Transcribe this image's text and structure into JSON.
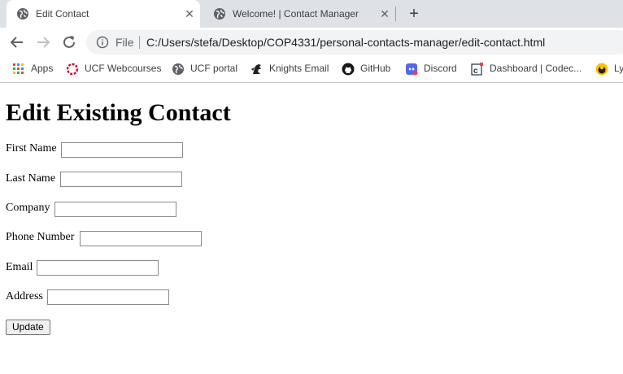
{
  "browser": {
    "tabs": [
      {
        "title": "Edit Contact",
        "close": "✕"
      },
      {
        "title": "Welcome! | Contact Manager",
        "close": "✕"
      }
    ],
    "new_tab": "+",
    "address": {
      "scheme_label": "File",
      "url": "C:/Users/stefa/Desktop/COP4331/personal-contacts-manager/edit-contact.html"
    },
    "bookmarks": [
      {
        "label": "Apps",
        "icon": "apps-grid-icon"
      },
      {
        "label": "UCF Webcourses",
        "icon": "webcourses-icon"
      },
      {
        "label": "UCF portal",
        "icon": "globe-icon"
      },
      {
        "label": "Knights Email",
        "icon": "knights-icon"
      },
      {
        "label": "GitHub",
        "icon": "github-icon"
      },
      {
        "label": "Discord",
        "icon": "discord-icon"
      },
      {
        "label": "Dashboard | Codec...",
        "icon": "codecademy-icon"
      },
      {
        "label": "Ly",
        "icon": "ly-icon"
      }
    ]
  },
  "page": {
    "heading": "Edit Existing Contact",
    "fields": [
      {
        "label": "First Name",
        "value": ""
      },
      {
        "label": "Last Name",
        "value": ""
      },
      {
        "label": "Company",
        "value": ""
      },
      {
        "label": "Phone Number",
        "value": ""
      },
      {
        "label": "Email",
        "value": ""
      },
      {
        "label": "Address",
        "value": ""
      }
    ],
    "submit_label": "Update"
  },
  "colors": {
    "tab_strip": "#dee1e6",
    "omnibox_bg": "#f1f3f4",
    "discord_red": "#ed4245",
    "webcourses_red": "#c8102e"
  }
}
